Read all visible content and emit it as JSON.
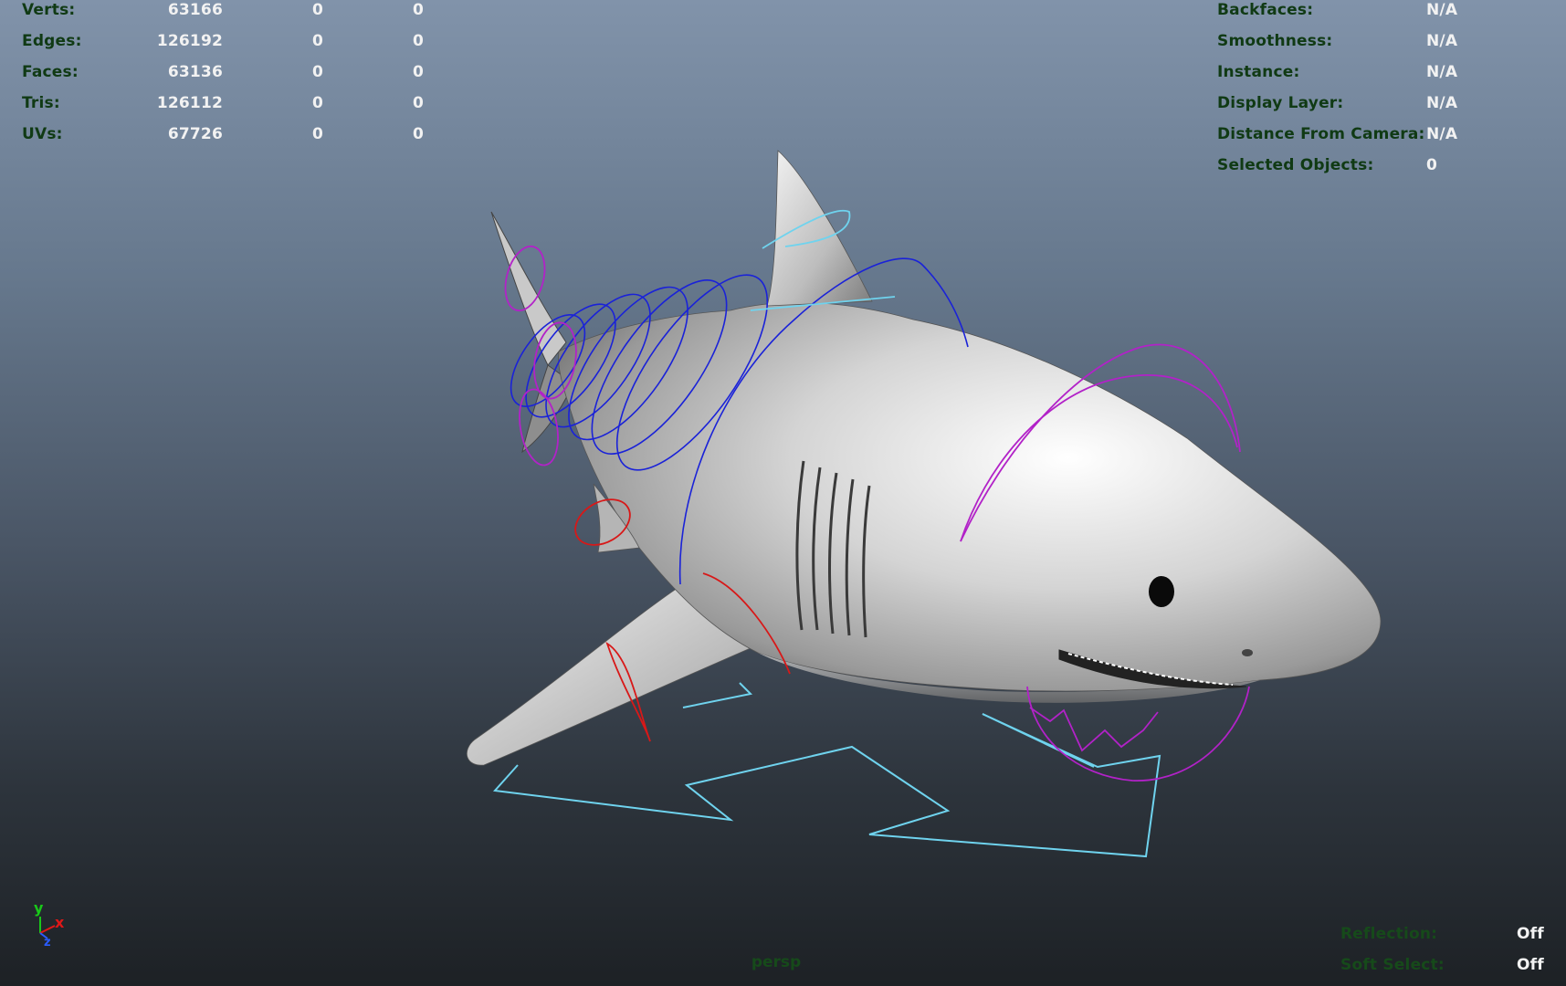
{
  "stats": [
    {
      "label": "Verts:",
      "v1": "63166",
      "v2": "0",
      "v3": "0"
    },
    {
      "label": "Edges:",
      "v1": "126192",
      "v2": "0",
      "v3": "0"
    },
    {
      "label": "Faces:",
      "v1": "63136",
      "v2": "0",
      "v3": "0"
    },
    {
      "label": "Tris:",
      "v1": "126112",
      "v2": "0",
      "v3": "0"
    },
    {
      "label": "UVs:",
      "v1": "67726",
      "v2": "0",
      "v3": "0"
    }
  ],
  "object_info": [
    {
      "label": "Backfaces:",
      "value": "N/A"
    },
    {
      "label": "Smoothness:",
      "value": "N/A"
    },
    {
      "label": "Instance:",
      "value": "N/A"
    },
    {
      "label": "Display Layer:",
      "value": "N/A"
    },
    {
      "label": "Distance From Camera:",
      "value": "N/A"
    },
    {
      "label": "Selected Objects:",
      "value": "0"
    }
  ],
  "display_info": [
    {
      "label": "Reflection:",
      "value": "Off"
    },
    {
      "label": "Soft Select:",
      "value": "Off"
    }
  ],
  "camera": "persp",
  "axis": {
    "y": "y",
    "z": "z",
    "x": "x"
  },
  "colors": {
    "hud_label": "#103a14",
    "hud_value": "#f2f2f2",
    "control_cyan": "#6fd3ee",
    "control_blue": "#1a22d8",
    "control_magenta": "#b222c8",
    "control_red": "#d81818",
    "axis_y": "#19c819",
    "axis_x": "#e01818",
    "axis_z": "#2a5cff"
  },
  "model": {
    "name_icon": "shark-model-icon"
  }
}
